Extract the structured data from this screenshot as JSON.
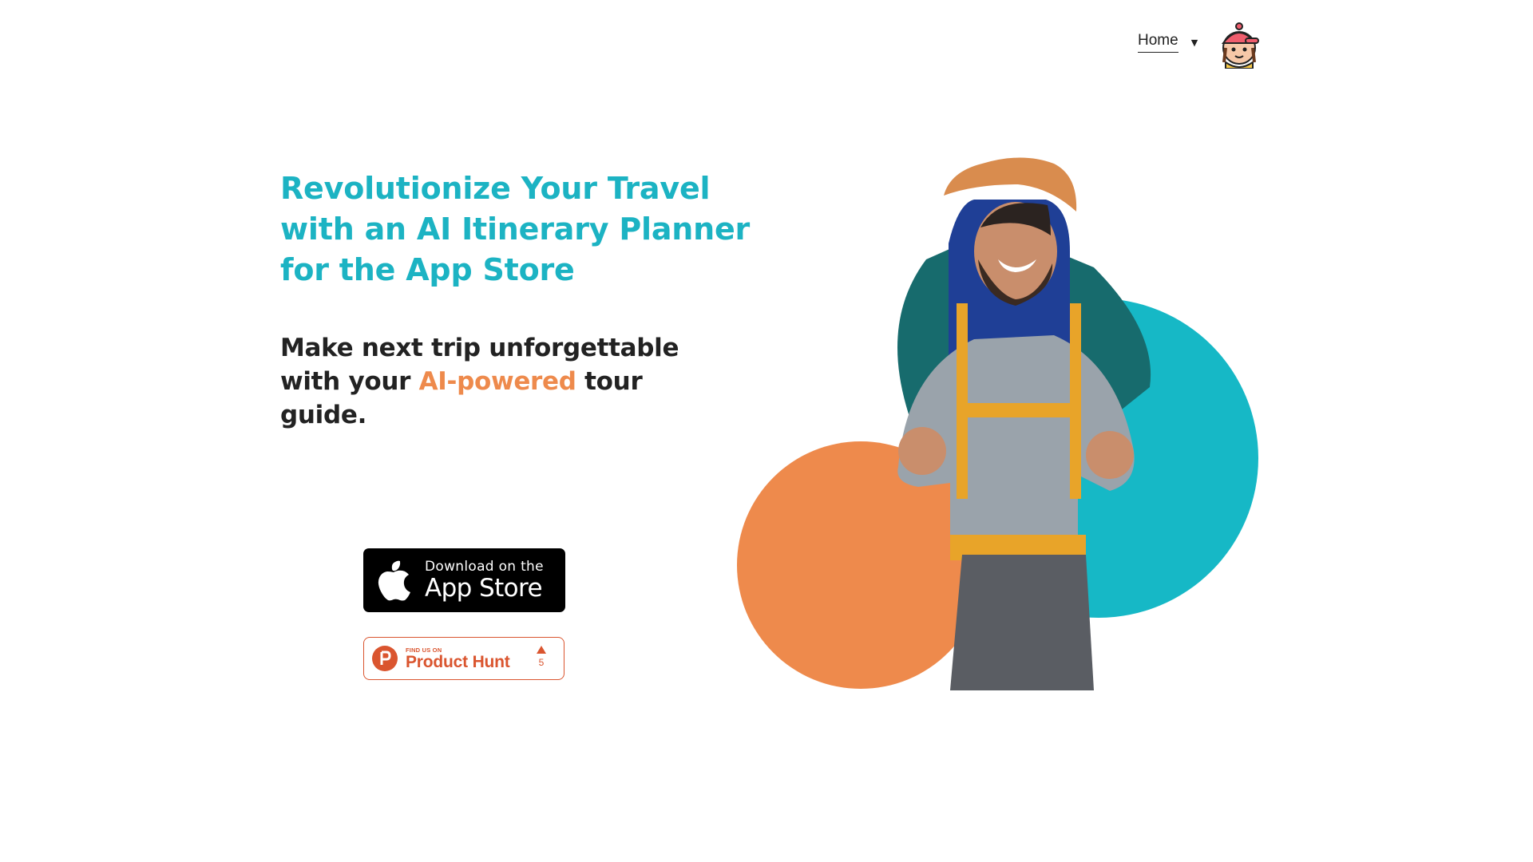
{
  "nav": {
    "home_label": "Home",
    "caret": "▼"
  },
  "hero": {
    "headline": "Revolutionize Your Travel with an AI Itinerary Planner for the App Store",
    "sub_before": "Make next trip unforgettable with your ",
    "sub_accent": "AI-powered",
    "sub_after": " tour guide."
  },
  "appstore": {
    "small": "Download on the",
    "big": "App Store"
  },
  "producthunt": {
    "small": "FIND US ON",
    "big": "Product Hunt",
    "votes": "5"
  },
  "colors": {
    "teal": "#1cb3c3",
    "orange": "#ee8a4c",
    "text": "#222222",
    "product_hunt": "#da552f"
  }
}
